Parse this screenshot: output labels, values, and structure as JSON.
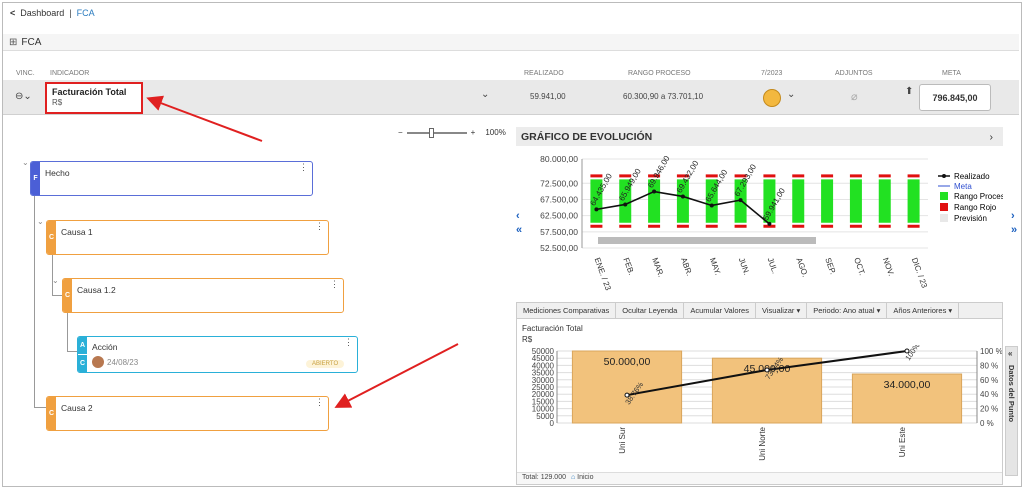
{
  "breadcrumb": {
    "back": "<",
    "root": "Dashboard",
    "current": "FCA"
  },
  "page": {
    "title": "FCA"
  },
  "columns": {
    "vinc": "VINC.",
    "indicador": "INDICADOR",
    "realizado": "REALIZADO",
    "rango": "RANGO PROCESO",
    "period": "7/2023",
    "adjuntos": "ADJUNTOS",
    "meta": "META"
  },
  "indicator_row": {
    "name": "Facturación Total",
    "unit": "R$",
    "realizado": "59.941,00",
    "rango": "60.300,90 a 73.701,10",
    "meta": "796.845,00"
  },
  "zoom": {
    "minus": "−",
    "plus": "+",
    "level": "100%"
  },
  "tree": [
    {
      "tag": "F",
      "label": "Hecho"
    },
    {
      "tag": "C",
      "label": "Causa 1"
    },
    {
      "tag": "C",
      "label": "Causa 1.2"
    },
    {
      "tag": "A",
      "tag2": "C",
      "label": "Acción",
      "date": "24/08/23",
      "status": "ABIERTO"
    },
    {
      "tag": "C",
      "label": "Causa 2"
    }
  ],
  "evolution": {
    "title": "GRÁFICO DE EVOLUCIÓN",
    "legend": [
      "Realizado",
      "Meta",
      "Rango Proceso",
      "Rango Rojo",
      "Previsión"
    ]
  },
  "toolbar": {
    "items": [
      "Mediciones Comparativas",
      "Ocultar Leyenda",
      "Acumular Valores",
      "Visualizar ▾",
      "Periodo: Ano atual ▾",
      "Años Anteriores ▾"
    ]
  },
  "comparative": {
    "title": "Facturación Total",
    "unit": "R$"
  },
  "side_tab": "Datos del Punto",
  "footer": {
    "total_label": "Total:",
    "total_value": "129.000",
    "inicio": "Inicio"
  },
  "colors": {
    "accent": "#2a7bbf",
    "range_green": "#22e122",
    "range_red": "#e01010",
    "bar_orange": "#f2c27c",
    "highlight": "#e02020"
  },
  "chart_data": [
    {
      "type": "line",
      "categories": [
        "ENE. / 23",
        "FEB.",
        "MAR.",
        "ABR.",
        "MAY.",
        "JUN.",
        "JUL.",
        "AGO.",
        "SEP.",
        "OCT.",
        "NOV.",
        "DIC. / 23"
      ],
      "y_ticks": [
        "80.000,00",
        "72.500,00",
        "67.500,00",
        "62.500,00",
        "57.500,00",
        "52.500,00"
      ],
      "ylim": [
        52500,
        80000
      ],
      "series": [
        {
          "name": "Realizado",
          "values": [
            64435,
            65949,
            69946,
            68432,
            65644,
            67293,
            59941,
            null,
            null,
            null,
            null,
            null
          ],
          "labels": [
            "64.435,00",
            "65.949,00",
            "69.946,00",
            "69.432,00",
            "65.644,00",
            "67.293,00",
            "59.941,00"
          ]
        },
        {
          "name": "Rango Proceso",
          "low": 60300.9,
          "high": 73701.1
        }
      ]
    },
    {
      "type": "bar",
      "categories": [
        "Uni Sur",
        "Uni Norte",
        "Uni Este"
      ],
      "values": [
        50000,
        45000,
        34000
      ],
      "value_labels": [
        "50.000,00",
        "45.000,00",
        "34.000,00"
      ],
      "cumulative_pct": [
        38.76,
        73.64,
        100
      ],
      "cumulative_labels": [
        "38.76%",
        "73.64%",
        "100%"
      ],
      "y_ticks": [
        "50000",
        "45000",
        "40000",
        "35000",
        "30000",
        "25000",
        "20000",
        "15000",
        "10000",
        "5000",
        "0"
      ],
      "y2_ticks": [
        "100 %",
        "80 %",
        "60 %",
        "40 %",
        "20 %",
        "0 %"
      ],
      "ylim": [
        0,
        50000
      ]
    }
  ]
}
